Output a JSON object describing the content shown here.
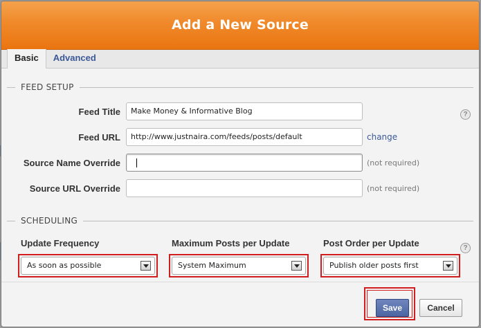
{
  "dialog": {
    "title": "Add a New Source"
  },
  "tabs": [
    {
      "label": "Basic",
      "active": true
    },
    {
      "label": "Advanced",
      "active": false
    }
  ],
  "feed_setup": {
    "heading": "FEED SETUP",
    "fields": [
      {
        "label": "Feed Title",
        "value": "Make Money & Informative Blog",
        "note": ""
      },
      {
        "label": "Feed URL",
        "value": "http://www.justnaira.com/feeds/posts/default",
        "link": "change"
      },
      {
        "label": "Source Name Override",
        "value": "",
        "note": "(not required)"
      },
      {
        "label": "Source URL Override",
        "value": "",
        "note": "(not required)"
      }
    ]
  },
  "scheduling": {
    "heading": "SCHEDULING",
    "update_frequency": {
      "label": "Update Frequency",
      "selected": "As soon as possible"
    },
    "max_posts": {
      "label": "Maximum Posts per Update",
      "selected": "System Maximum"
    },
    "post_order": {
      "label": "Post Order per Update",
      "selected": "Publish older posts first"
    }
  },
  "help_icon_glyph": "?",
  "buttons": {
    "save": "Save",
    "cancel": "Cancel"
  },
  "colors": {
    "title_bar": "#f0892a",
    "link": "#3b5998",
    "highlight_outline": "#d01e1e",
    "save_button": "#4c65a1"
  }
}
